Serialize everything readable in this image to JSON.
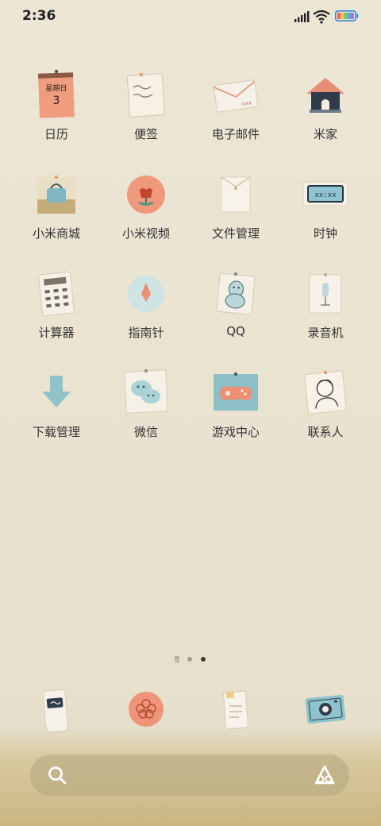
{
  "status_bar": {
    "time": "2:36",
    "icons": [
      "signal-icon",
      "wifi-icon",
      "battery-icon"
    ]
  },
  "apps": [
    {
      "label": "日历",
      "icon": "calendar-icon",
      "calendar_weekday": "星期日",
      "calendar_day": "3"
    },
    {
      "label": "便签",
      "icon": "notes-icon"
    },
    {
      "label": "电子邮件",
      "icon": "email-icon"
    },
    {
      "label": "米家",
      "icon": "mihome-icon"
    },
    {
      "label": "小米商城",
      "icon": "mi-store-icon"
    },
    {
      "label": "小米视频",
      "icon": "mi-video-icon"
    },
    {
      "label": "文件管理",
      "icon": "file-manager-icon"
    },
    {
      "label": "时钟",
      "icon": "clock-icon"
    },
    {
      "label": "计算器",
      "icon": "calculator-icon"
    },
    {
      "label": "指南针",
      "icon": "compass-icon"
    },
    {
      "label": "QQ",
      "icon": "qq-icon"
    },
    {
      "label": "录音机",
      "icon": "recorder-icon"
    },
    {
      "label": "下载管理",
      "icon": "download-icon"
    },
    {
      "label": "微信",
      "icon": "wechat-icon"
    },
    {
      "label": "游戏中心",
      "icon": "game-center-icon"
    },
    {
      "label": "联系人",
      "icon": "contacts-icon"
    }
  ],
  "page_indicator": {
    "pages": 3,
    "current": 3
  },
  "dock": [
    "phone-icon",
    "message-icon",
    "notes-dock-icon",
    "camera-icon"
  ],
  "search_bar": {
    "icons": [
      "search-icon",
      "assistant-icon"
    ]
  }
}
